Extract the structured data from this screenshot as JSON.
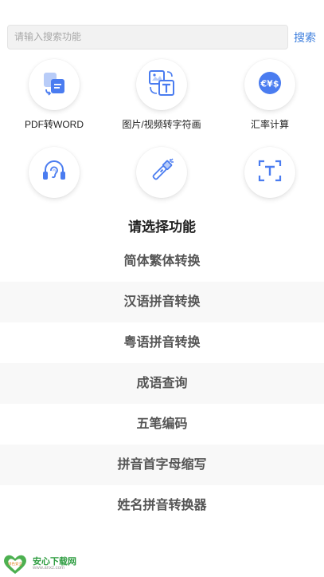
{
  "search": {
    "placeholder": "请输入搜索功能",
    "button_label": "搜索"
  },
  "tools": [
    {
      "label": "PDF转WORD",
      "icon": "pdf-convert-icon"
    },
    {
      "label": "图片/视频转字符画",
      "icon": "image-text-icon"
    },
    {
      "label": "汇率计算",
      "icon": "currency-exchange-icon"
    },
    {
      "label": "",
      "icon": "headphones-ear-icon"
    },
    {
      "label": "",
      "icon": "flashlight-icon"
    },
    {
      "label": "",
      "icon": "text-scan-icon"
    }
  ],
  "section_title": "请选择功能",
  "menu": [
    "简体繁体转换",
    "汉语拼音转换",
    "粤语拼音转换",
    "成语查询",
    "五笔编码",
    "拼音首字母缩写",
    "姓名拼音转换器"
  ],
  "watermark": {
    "brand": "安心下载网",
    "url": "www.anxz.com",
    "badge": "绿色安全"
  },
  "colors": {
    "accent": "#3b7ddd",
    "icon_blue": "#4a7cf0",
    "watermark_green": "#2b9b3e"
  }
}
